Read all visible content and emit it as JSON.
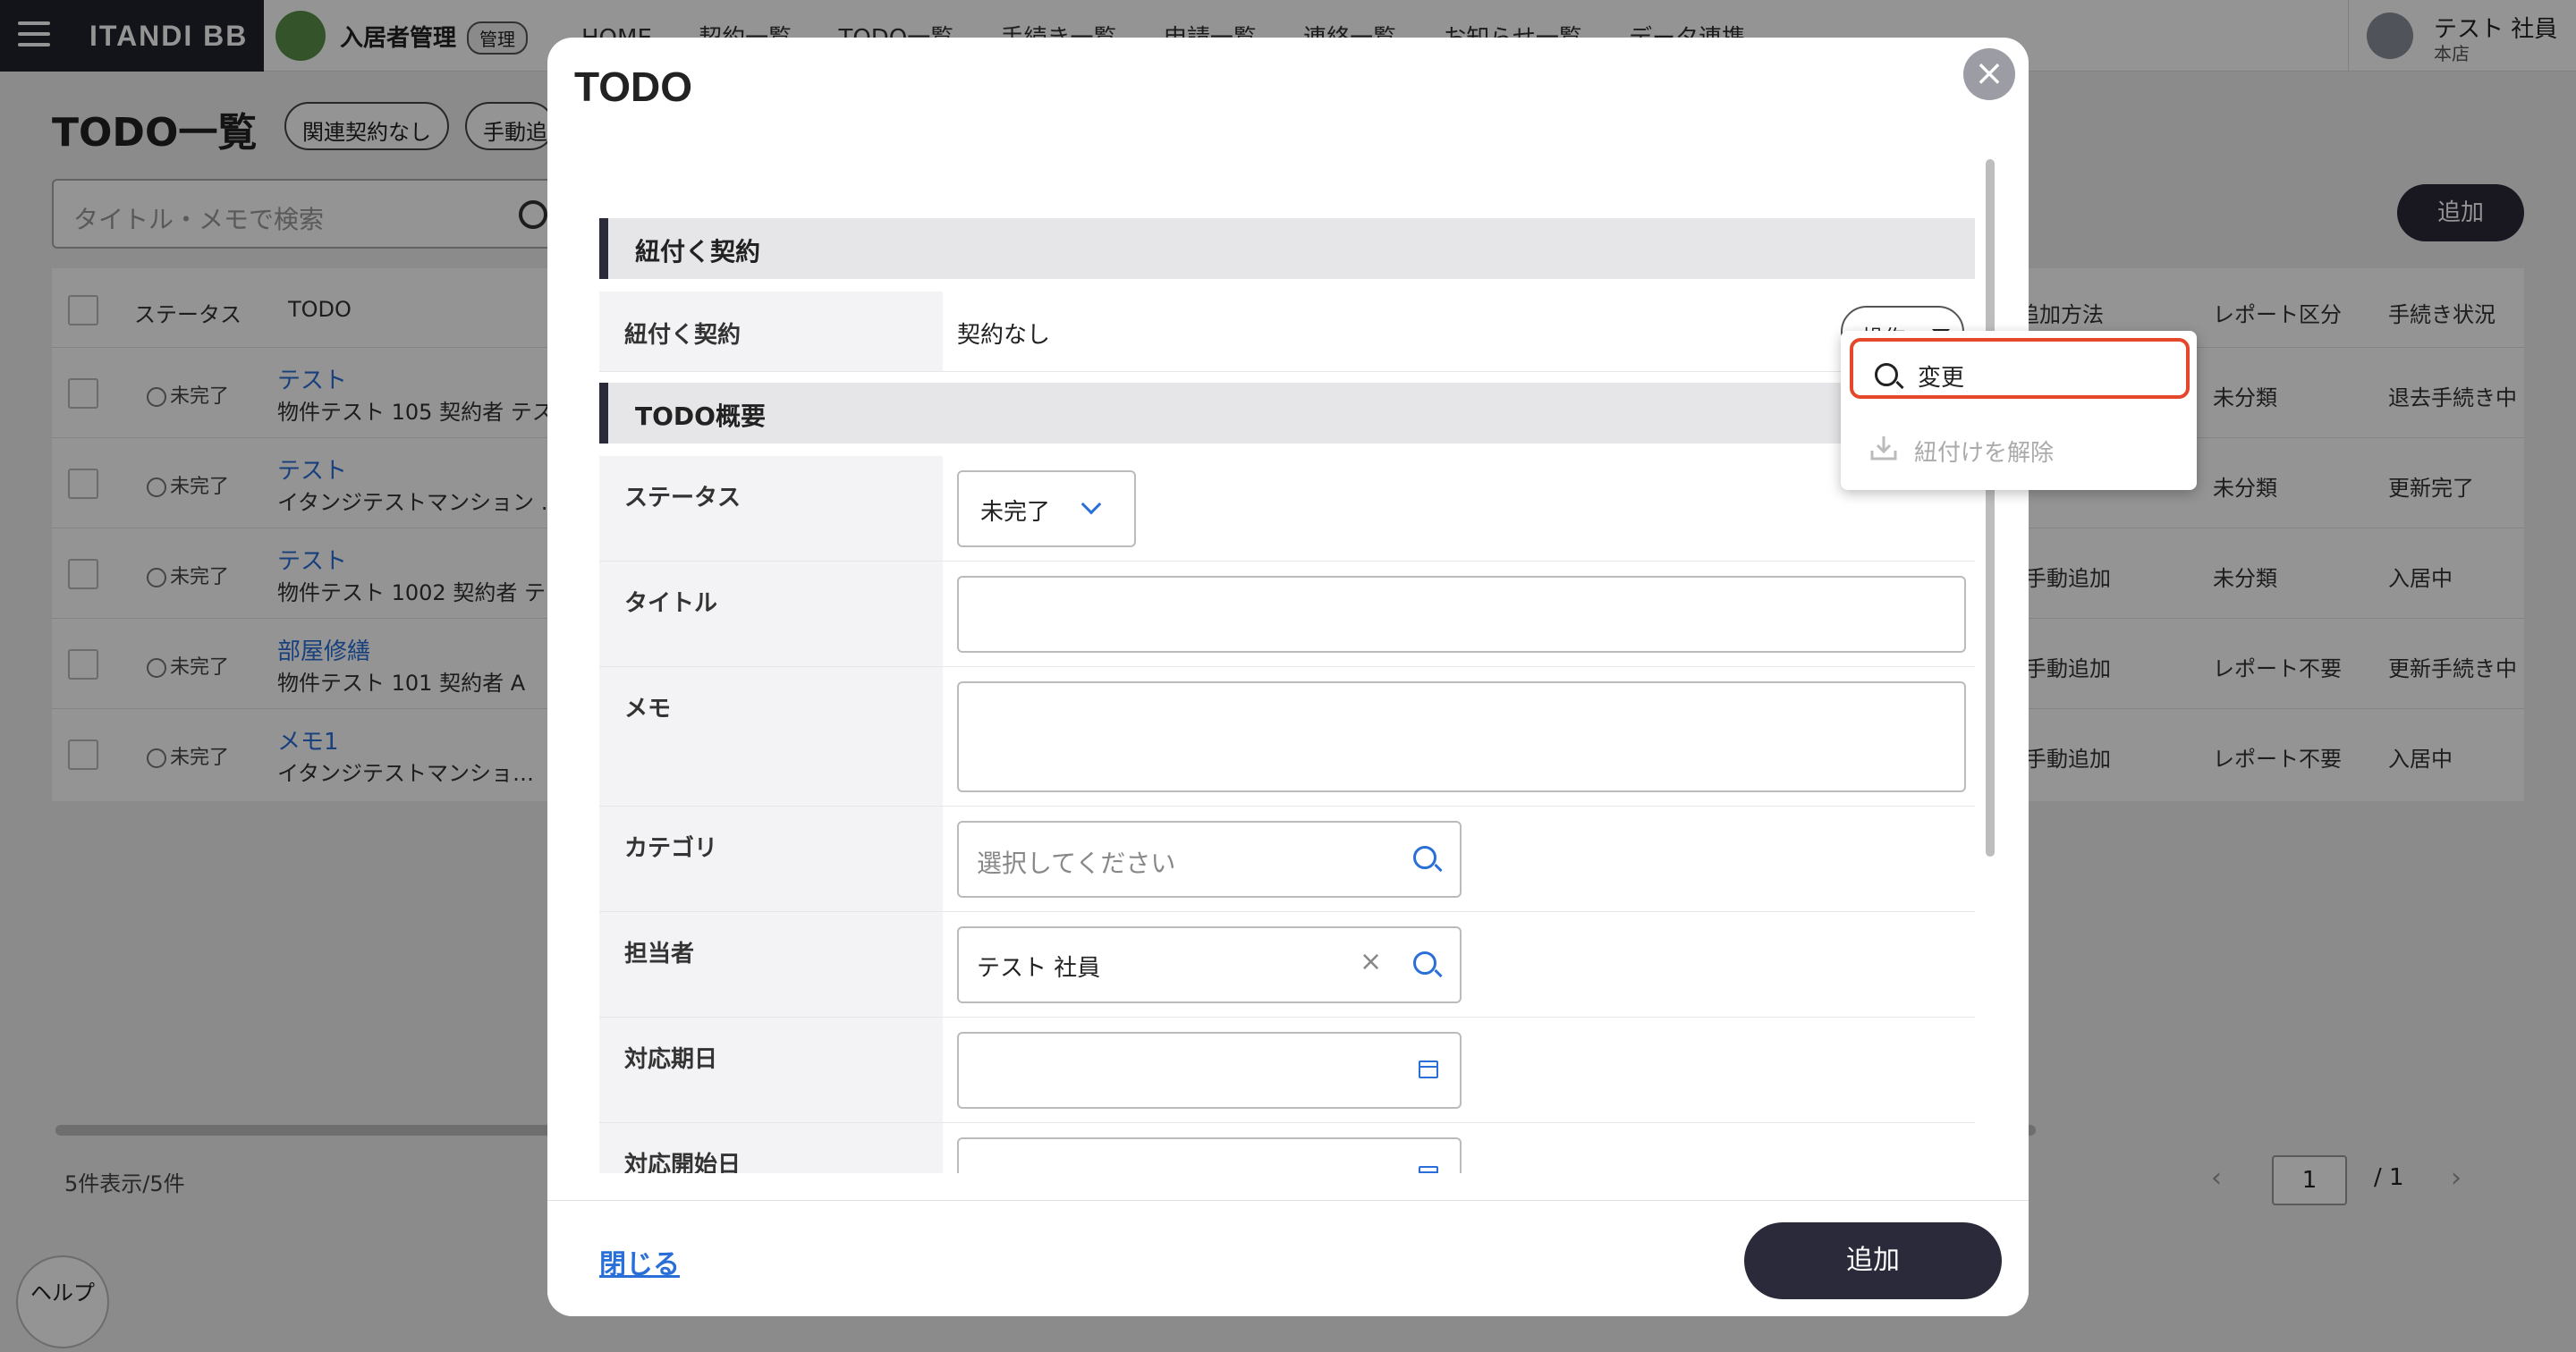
{
  "header": {
    "brand": "ITANDI BB",
    "app_name": "入居者管理",
    "admin_badge": "管理",
    "nav": [
      "HOME",
      "契約一覧",
      "TODO一覧",
      "手続き一覧",
      "申請一覧",
      "連絡一覧",
      "お知らせ一覧",
      "データ連携"
    ],
    "user_name": "テスト 社員",
    "user_store": "本店"
  },
  "background": {
    "page_title": "TODO一覧",
    "chips": [
      "関連契約なし",
      "手動追"
    ],
    "search_placeholder": "タイトル・メモで検索",
    "add_label": "追加",
    "columns": [
      "ステータス",
      "TODO",
      "追加方法",
      "レポート区分",
      "手続き状況"
    ],
    "rows": [
      {
        "status": "未完了",
        "title": "テスト",
        "sub": "物件テスト 105  契約者 テス",
        "method": "",
        "report": "未分類",
        "proc": "退去手続き中"
      },
      {
        "status": "未完了",
        "title": "テスト",
        "sub": "イタンジテストマンション …",
        "method": "",
        "report": "未分類",
        "proc": "更新完了"
      },
      {
        "status": "未完了",
        "title": "テスト",
        "sub": "物件テスト 1002  契約者 テ",
        "method": "手動追加",
        "report": "未分類",
        "proc": "入居中"
      },
      {
        "status": "未完了",
        "title": "部屋修繕",
        "sub": "物件テスト 101  契約者 A",
        "method": "手動追加",
        "report": "レポート不要",
        "proc": "更新手続き中"
      },
      {
        "status": "未完了",
        "title": "メモ1",
        "sub": "イタンジテストマンショ…",
        "method": "手動追加",
        "report": "レポート不要",
        "proc": "入居中"
      }
    ],
    "count_text": "5件表示/5件",
    "page_input": "1",
    "page_total": "/ 1",
    "help_label": "ヘルプ"
  },
  "modal": {
    "title": "TODO",
    "close_icon": "×",
    "section_contract": "紐付く契約",
    "contract_label": "紐付く契約",
    "contract_value": "契約なし",
    "operation_button": "操作",
    "section_overview": "TODO概要",
    "fields": {
      "status_label": "ステータス",
      "status_value": "未完了",
      "title_label": "タイトル",
      "memo_label": "メモ",
      "category_label": "カテゴリ",
      "category_placeholder": "選択してください",
      "assignee_label": "担当者",
      "assignee_value": "テスト 社員",
      "due_label": "対応期日",
      "start_label": "対応開始日"
    },
    "footer_close": "閉じる",
    "footer_submit": "追加"
  },
  "dropdown": {
    "items": [
      "変更",
      "紐付けを解除"
    ]
  },
  "colors": {
    "accent": "#2a6fd8",
    "dark": "#2b2a3a",
    "highlight": "#e4472a"
  }
}
